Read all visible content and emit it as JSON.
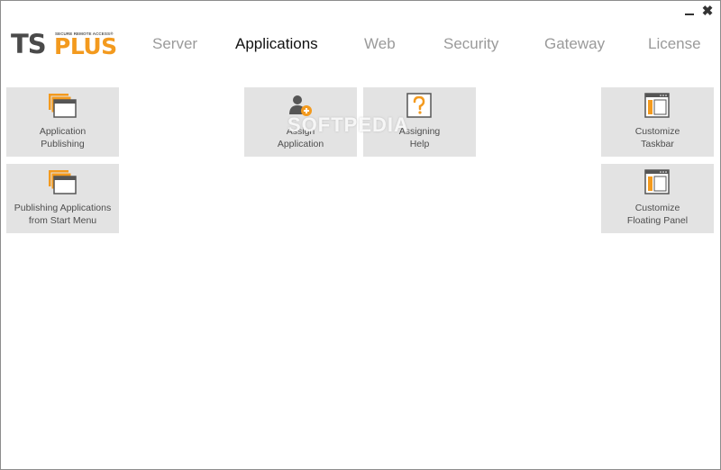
{
  "window": {
    "minimize_icon": "minimize-icon",
    "close_icon": "close-icon",
    "close_glyph": "✖"
  },
  "logo": {
    "ts": "TS",
    "plus": "PLUS",
    "tagline": "SECURE REMOTE ACCESS®",
    "accent_color": "#f39a1e"
  },
  "nav": {
    "tabs": [
      {
        "label": "Server"
      },
      {
        "label": "Applications",
        "active": true
      },
      {
        "label": "Web"
      },
      {
        "label": "Security"
      },
      {
        "label": "Gateway"
      },
      {
        "label": "License"
      }
    ]
  },
  "tiles": {
    "app_publishing": {
      "line1": "Application",
      "line2": "Publishing",
      "icon": "windows-stack-icon"
    },
    "publishing_start_menu": {
      "line1": "Publishing Applications",
      "line2": "from Start Menu",
      "icon": "windows-stack-icon"
    },
    "assign_application": {
      "line1": "Assign",
      "line2": "Application",
      "icon": "user-add-icon"
    },
    "assigning_help": {
      "line1": "Assigning",
      "line2": "Help",
      "icon": "help-icon"
    },
    "customize_taskbar": {
      "line1": "Customize",
      "line2": "Taskbar",
      "icon": "taskbar-icon"
    },
    "customize_floating_panel": {
      "line1": "Customize",
      "line2": "Floating Panel",
      "icon": "floating-panel-icon"
    }
  },
  "watermark": "SOFTPEDIA"
}
